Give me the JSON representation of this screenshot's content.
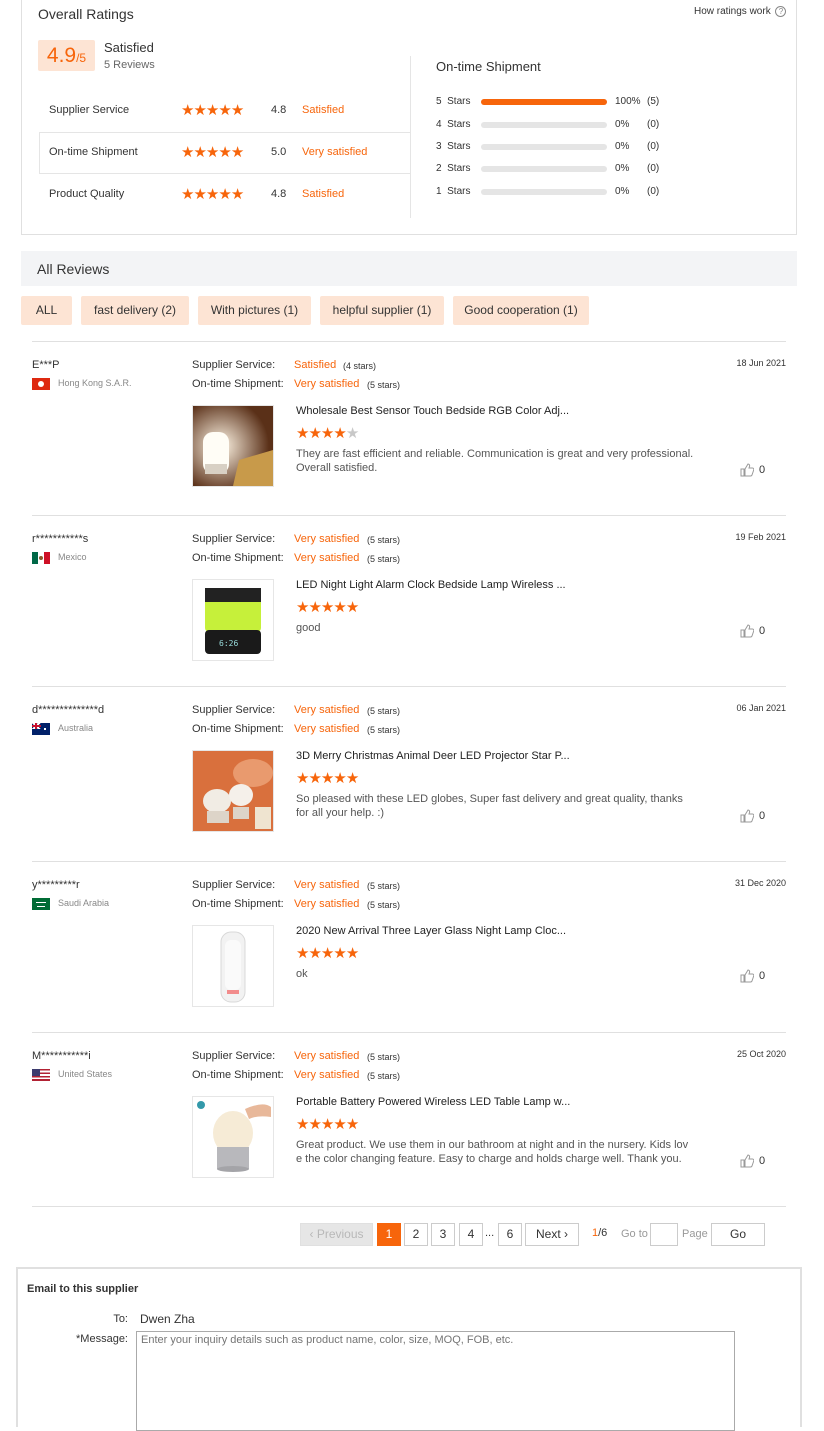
{
  "overall": {
    "title": "Overall Ratings",
    "how_link": "How ratings work",
    "score": "4.9",
    "score_max": "/5",
    "label": "Satisfied",
    "reviews_count": "5 Reviews",
    "categories": [
      {
        "name": "Supplier Service",
        "score": "4.8",
        "desc": "Satisfied",
        "stars": 5
      },
      {
        "name": "On-time Shipment",
        "score": "5.0",
        "desc": "Very satisfied",
        "stars": 5
      },
      {
        "name": "Product Quality",
        "score": "4.8",
        "desc": "Satisfied",
        "stars": 5
      }
    ]
  },
  "shipment": {
    "title": "On-time Shipment",
    "rows": [
      {
        "label": "5  Stars",
        "percent_text": "100%",
        "count": "(5)",
        "fill": 1.0
      },
      {
        "label": "4  Stars",
        "percent_text": "0%",
        "count": "(0)",
        "fill": 0
      },
      {
        "label": "3  Stars",
        "percent_text": "0%",
        "count": "(0)",
        "fill": 0
      },
      {
        "label": "2  Stars",
        "percent_text": "0%",
        "count": "(0)",
        "fill": 0
      },
      {
        "label": "1  Stars",
        "percent_text": "0%",
        "count": "(0)",
        "fill": 0
      }
    ]
  },
  "all_reviews": {
    "title": "All Reviews",
    "filters": [
      "ALL",
      "fast delivery (2)",
      "With pictures (1)",
      "helpful supplier (1)",
      "Good cooperation (1)"
    ]
  },
  "labels": {
    "supplier_service": "Supplier Service:",
    "ontime_shipment": "On-time Shipment:"
  },
  "reviews": [
    {
      "user": "E***P",
      "country": "Hong Kong S.A.R.",
      "date": "18 Jun 2021",
      "service_desc": "Satisfied",
      "service_stars": "(4 stars)",
      "shipment_desc": "Very satisfied",
      "shipment_stars": "(5 stars)",
      "product": "Wholesale Best Sensor Touch Bedside RGB Color Adj...",
      "product_rating": 4,
      "text": "They are fast efficient and reliable. Communication is great and very professional. Overall satisfied.",
      "likes": "0"
    },
    {
      "user": "r***********s",
      "country": "Mexico",
      "date": "19 Feb 2021",
      "service_desc": "Very satisfied",
      "service_stars": "(5 stars)",
      "shipment_desc": "Very satisfied",
      "shipment_stars": "(5 stars)",
      "product": "LED Night Light Alarm Clock Bedside Lamp Wireless ...",
      "product_rating": 5,
      "text": "good",
      "likes": "0"
    },
    {
      "user": "d**************d",
      "country": "Australia",
      "date": "06 Jan 2021",
      "service_desc": "Very satisfied",
      "service_stars": "(5 stars)",
      "shipment_desc": "Very satisfied",
      "shipment_stars": "(5 stars)",
      "product": "3D Merry Christmas Animal Deer LED Projector Star P...",
      "product_rating": 5,
      "text": "So pleased with these LED globes, Super fast delivery and great quality, thanks for all your help. :)",
      "likes": "0"
    },
    {
      "user": "y*********r",
      "country": "Saudi Arabia",
      "date": "31 Dec 2020",
      "service_desc": "Very satisfied",
      "service_stars": "(5 stars)",
      "shipment_desc": "Very satisfied",
      "shipment_stars": "(5 stars)",
      "product": "2020 New Arrival Three Layer Glass Night Lamp Cloc...",
      "product_rating": 5,
      "text": "ok",
      "likes": "0"
    },
    {
      "user": "M***********i",
      "country": "United States",
      "date": "25 Oct 2020",
      "service_desc": "Very satisfied",
      "service_stars": "(5 stars)",
      "shipment_desc": "Very satisfied",
      "shipment_stars": "(5 stars)",
      "product": "Portable Battery Powered Wireless LED Table Lamp w...",
      "product_rating": 5,
      "text": "Great product.  We use them in our bathroom at night and in the nursery.  Kids lov e the color changing feature.  Easy to charge and holds charge well.  Thank you.",
      "likes": "0"
    }
  ],
  "pagination": {
    "previous": "Previous",
    "pages": [
      "1",
      "2",
      "3",
      "4"
    ],
    "ellipsis": "...",
    "last_page": "6",
    "next": "Next",
    "current": "1",
    "total": "/6",
    "goto_label": "Go to",
    "goto_value": "",
    "page_label": "Page",
    "go_button": "Go"
  },
  "email": {
    "title": "Email to this supplier",
    "to_label": "To:",
    "to_value": "Dwen Zha",
    "message_label": "*Message:",
    "message_placeholder": "Enter your inquiry details such as product name, color, size, MOQ, FOB, etc."
  },
  "colors": {
    "accent": "#f7650b",
    "chip_bg": "#fde4d4",
    "header_bg": "#f3f4f6"
  }
}
